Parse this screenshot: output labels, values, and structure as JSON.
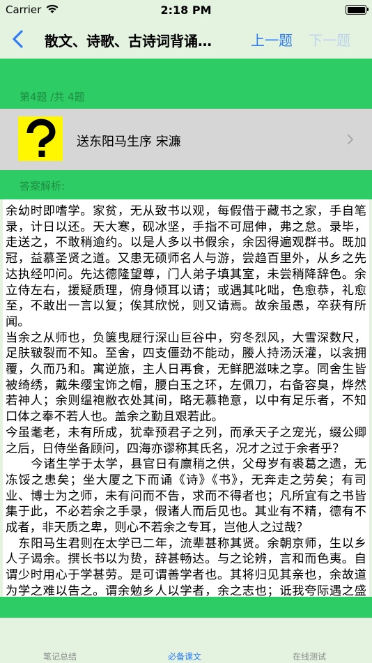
{
  "status_bar": {
    "carrier": "Carrier",
    "time": "2:18 PM"
  },
  "nav": {
    "title": "散文、诗歌、古诗词背诵…",
    "prev_label": "上一题",
    "next_label": "下一题"
  },
  "question": {
    "counter": "第4题 /共 4题",
    "title": "送东阳马生序   宋濂"
  },
  "answer": {
    "label": "答案解析:",
    "paragraphs": [
      "余幼时即嗜学。家贫，无从致书以观，每假借于藏书之家，手自笔录，计日以还。天大寒，砚冰坚，手指不可屈伸，弗之怠。录毕，走送之，不敢稍逾约。以是人多以书假余，余因得遍观群书。既加冠，益慕圣贤之道。又患无硕师名人与游，尝趋百里外，从乡之先达执经叩问。先达德隆望尊，门人弟子填其室，未尝稍降辞色。余立侍左右，援疑质理，俯身倾耳以请；或遇其叱咄，色愈恭，礼愈至，不敢出一言以复；俟其欣悦，则又请焉。故余虽愚，卒获有所闻。",
      "当余之从师也，负箧曳屣行深山巨谷中，穷冬烈风，大雪深数尺，足肤皲裂而不知。至舍，四支僵劲不能动，媵人持汤沃灌，以衾拥覆，久而乃和。寓逆旅，主人日再食，无鲜肥滋味之享。同舍生皆被绮绣，戴朱缨宝饰之帽，腰白玉之环，左佩刀，右备容臭，烨然若神人；余则缊袍敝衣处其间，略无慕艳意，以中有足乐者，不知口体之奉不若人也。盖余之勤且艰若此。",
      "今虽耄老，未有所成，犹幸预君子之列，而承天子之宠光，缀公卿之后，日侍坐备顾问，四海亦谬称其氏名，况才之过于余者乎？",
      "      今诸生学于太学，县官日有廪稍之供，父母岁有裘葛之遗，无冻馁之患矣；坐大厦之下而诵《诗》《书》，无奔走之劳矣；有司业、博士为之师，未有问而不告，求而不得者也；凡所宜有之书皆集于此，不必若余之手录，假诸人而后见也。其业有不精，德有不成者，非天质之卑，则心不若余之专耳，岂他人之过哉？",
      "   东阳马生君则在太学已二年，流辈甚称其贤。余朝京师，生以乡人子谒余。撰长书以为贽，辞甚畅达。与之论辨，言和而色夷。自谓少时用心于学甚劳。是可谓善学者也。其将归见其亲也，余故道为学之难以告之。谓余勉乡人以学者，余之志也；诋我夸际遇之盛而骄乡人者，岂知余者哉！"
    ]
  },
  "tabs": [
    {
      "label": "笔记总结"
    },
    {
      "label": "必备课文"
    },
    {
      "label": "在线测试"
    }
  ],
  "colors": {
    "accent": "#2F7CF6",
    "green": "#2DCC64",
    "background": "#E3F3E0"
  }
}
